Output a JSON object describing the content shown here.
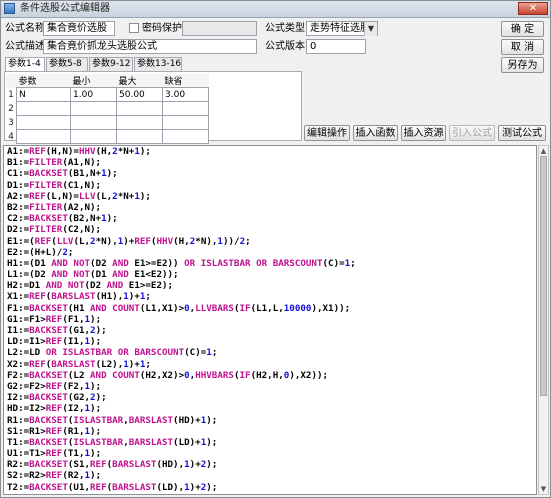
{
  "window": {
    "title": "条件选股公式编辑器",
    "close_glyph": "✕"
  },
  "form": {
    "name_label": "公式名称",
    "name_value": "集合竟价选股",
    "password_label": "密码保护",
    "type_label": "公式类型",
    "type_value": "走势特征选股",
    "desc_label": "公式描述",
    "desc_value": "集合竟价抓龙头选股公式",
    "version_label": "公式版本",
    "version_value": "0"
  },
  "buttons": {
    "ok": "确 定",
    "cancel": "取 消",
    "save_as": "另存为",
    "edit_ops": "编辑操作",
    "insert_func": "插入函数",
    "insert_res": "插入资源",
    "import_formula": "引入公式",
    "test_formula": "测试公式"
  },
  "tabs": [
    "参数1-4",
    "参数5-8",
    "参数9-12",
    "参数13-16"
  ],
  "params": {
    "headers": [
      "参数",
      "最小",
      "最大",
      "缺省"
    ],
    "rows": [
      {
        "n": "1",
        "name": "N",
        "min": "1.00",
        "max": "50.00",
        "def": "3.00"
      },
      {
        "n": "2",
        "name": "",
        "min": "",
        "max": "",
        "def": ""
      },
      {
        "n": "3",
        "name": "",
        "min": "",
        "max": "",
        "def": ""
      },
      {
        "n": "4",
        "name": "",
        "min": "",
        "max": "",
        "def": ""
      }
    ]
  },
  "code": [
    "A1:=REF(H,N)=HHV(H,2*N+1);",
    "B1:=FILTER(A1,N);",
    "C1:=BACKSET(B1,N+1);",
    "D1:=FILTER(C1,N);",
    "A2:=REF(L,N)=LLV(L,2*N+1);",
    "B2:=FILTER(A2,N);",
    "C2:=BACKSET(B2,N+1);",
    "D2:=FILTER(C2,N);",
    "E1:=(REF(LLV(L,2*N),1)+REF(HHV(H,2*N),1))/2;",
    "E2:=(H+L)/2;",
    "H1:=(D1 AND NOT(D2 AND E1>=E2)) OR ISLASTBAR OR BARSCOUNT(C)=1;",
    "L1:=(D2 AND NOT(D1 AND E1<E2));",
    "H2:=D1 AND NOT(D2 AND E1>=E2);",
    "X1:=REF(BARSLAST(H1),1)+1;",
    "F1:=BACKSET(H1 AND COUNT(L1,X1)>0,LLVBARS(IF(L1,L,10000),X1));",
    "G1:=F1>REF(F1,1);",
    "I1:=BACKSET(G1,2);",
    "LD:=I1>REF(I1,1);",
    "L2:=LD OR ISLASTBAR OR BARSCOUNT(C)=1;",
    "X2:=REF(BARSLAST(L2),1)+1;",
    "F2:=BACKSET(L2 AND COUNT(H2,X2)>0,HHVBARS(IF(H2,H,0),X2));",
    "G2:=F2>REF(F2,1);",
    "I2:=BACKSET(G2,2);",
    "HD:=I2>REF(I2,1);",
    "R1:=BACKSET(ISLASTBAR,BARSLAST(HD)+1);",
    "S1:=R1>REF(R1,1);",
    "T1:=BACKSET(ISLASTBAR,BARSLAST(LD)+1);",
    "U1:=T1>REF(T1,1);",
    "R2:=BACKSET(S1,REF(BARSLAST(HD),1)+2);",
    "S2:=R2>REF(R2,1);",
    "T2:=BACKSET(U1,REF(BARSLAST(LD),1)+2);"
  ],
  "colors": {
    "keyword": "#c0128f",
    "number": "#1010d8",
    "titlebar": "#c9d3de"
  }
}
